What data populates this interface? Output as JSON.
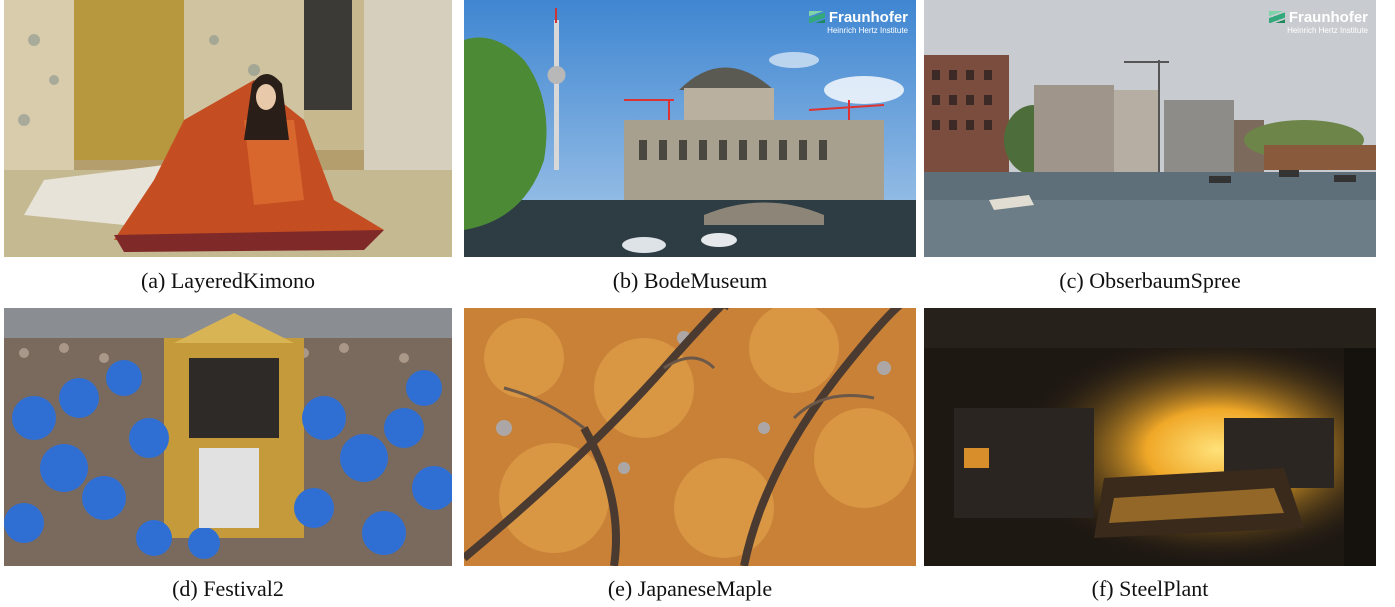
{
  "figure": {
    "panels": [
      {
        "caption": "(a) LayeredKimono",
        "scene": "woman in multi-layered orange kimono seated in a gold-screened tatami room"
      },
      {
        "caption": "(b) BodeMuseum",
        "scene": "domed museum by a river, TV tower and cranes under a blue sky",
        "logo": {
          "name": "Fraunhofer",
          "sub": "Heinrich Hertz Institute"
        }
      },
      {
        "caption": "(c) ObserbaumSpree",
        "scene": "river with small boats, waterfront buildings and a crane",
        "logo": {
          "name": "Fraunhofer",
          "sub": "Heinrich Hertz Institute"
        }
      },
      {
        "caption": "(d) Festival2",
        "scene": "crowded festival with golden portable shrine and blue pompoms"
      },
      {
        "caption": "(e) JapaneseMaple",
        "scene": "looking up through branches of an autumn maple tree"
      },
      {
        "caption": "(f) SteelPlant",
        "scene": "dark steel plant interior with glowing molten metal"
      }
    ]
  },
  "colors": {
    "kimono_bg": "#b9a77a",
    "museum_sky": "#5f9bd8",
    "river_sky": "#c9cdd1",
    "festival_blue": "#2f6fd4",
    "maple_orange": "#d48a35",
    "steel_glow": "#f2c24a"
  }
}
